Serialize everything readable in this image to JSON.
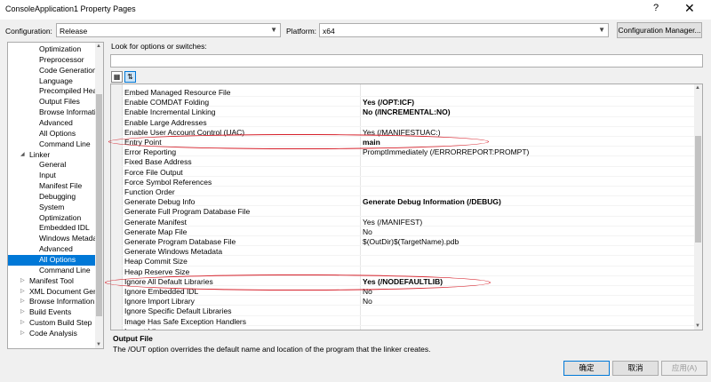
{
  "window": {
    "title": "ConsoleApplication1 Property Pages",
    "help": "?",
    "close": "✕"
  },
  "config": {
    "configuration_label": "Configuration:",
    "configuration_value": "Release",
    "platform_label": "Platform:",
    "platform_value": "x64",
    "manager_button": "Configuration Manager..."
  },
  "search": {
    "label": "Look for options or switches:",
    "value": ""
  },
  "tree": {
    "items": [
      {
        "label": "Optimization"
      },
      {
        "label": "Preprocessor"
      },
      {
        "label": "Code Generation"
      },
      {
        "label": "Language"
      },
      {
        "label": "Precompiled Head"
      },
      {
        "label": "Output Files"
      },
      {
        "label": "Browse Informatic"
      },
      {
        "label": "Advanced"
      },
      {
        "label": "All Options"
      },
      {
        "label": "Command Line"
      },
      {
        "label": "Linker"
      },
      {
        "label": "General"
      },
      {
        "label": "Input"
      },
      {
        "label": "Manifest File"
      },
      {
        "label": "Debugging"
      },
      {
        "label": "System"
      },
      {
        "label": "Optimization"
      },
      {
        "label": "Embedded IDL"
      },
      {
        "label": "Windows Metada"
      },
      {
        "label": "Advanced"
      },
      {
        "label": "All Options"
      },
      {
        "label": "Command Line"
      },
      {
        "label": "Manifest Tool"
      },
      {
        "label": "XML Document Gene"
      },
      {
        "label": "Browse Information"
      },
      {
        "label": "Build Events"
      },
      {
        "label": "Custom Build Step"
      },
      {
        "label": "Code Analysis"
      }
    ]
  },
  "grid": {
    "rows": [
      {
        "name": "Embed Managed Resource File",
        "value": ""
      },
      {
        "name": "Enable COMDAT Folding",
        "value": "Yes (/OPT:ICF)"
      },
      {
        "name": "Enable Incremental Linking",
        "value": "No (/INCREMENTAL:NO)"
      },
      {
        "name": "Enable Large Addresses",
        "value": ""
      },
      {
        "name": "Enable User Account Control (UAC)",
        "value": "Yes (/MANIFESTUAC:)"
      },
      {
        "name": "Entry Point",
        "value": "main"
      },
      {
        "name": "Error Reporting",
        "value": "PromptImmediately (/ERRORREPORT:PROMPT)"
      },
      {
        "name": "Fixed Base Address",
        "value": ""
      },
      {
        "name": "Force File Output",
        "value": ""
      },
      {
        "name": "Force Symbol References",
        "value": ""
      },
      {
        "name": "Function Order",
        "value": ""
      },
      {
        "name": "Generate Debug Info",
        "value": "Generate Debug Information (/DEBUG)"
      },
      {
        "name": "Generate Full Program Database File",
        "value": ""
      },
      {
        "name": "Generate Manifest",
        "value": "Yes (/MANIFEST)"
      },
      {
        "name": "Generate Map File",
        "value": "No"
      },
      {
        "name": "Generate Program Database File",
        "value": "$(OutDir)$(TargetName).pdb"
      },
      {
        "name": "Generate Windows Metadata",
        "value": ""
      },
      {
        "name": "Heap Commit Size",
        "value": ""
      },
      {
        "name": "Heap Reserve Size",
        "value": ""
      },
      {
        "name": "Ignore All Default Libraries",
        "value": "Yes (/NODEFAULTLIB)"
      },
      {
        "name": "Ignore Embedded IDL",
        "value": "No"
      },
      {
        "name": "Ignore Import Library",
        "value": "No"
      },
      {
        "name": "Ignore Specific Default Libraries",
        "value": ""
      },
      {
        "name": "Image Has Safe Exception Handlers",
        "value": ""
      },
      {
        "name": "Import Library",
        "value": ""
      }
    ]
  },
  "description": {
    "title": "Output File",
    "text": "The /OUT option overrides the default name and location of the program that the linker creates."
  },
  "buttons": {
    "ok": "确定",
    "cancel": "取消",
    "apply": "应用(A)"
  },
  "colors": {
    "selection": "#0078d7",
    "annotation": "#d6202a"
  }
}
